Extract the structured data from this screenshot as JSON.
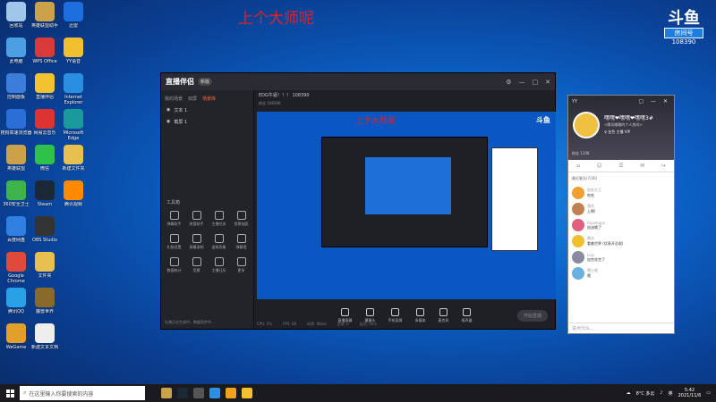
{
  "stream_title": "上个大师呢",
  "douyu": {
    "logo": "斗鱼",
    "room_label": "房间号",
    "room_id": "108390"
  },
  "desktop_icons": [
    {
      "label": "回收站",
      "color": "#9ec7e8"
    },
    {
      "label": "此电脑",
      "color": "#4aa0e0"
    },
    {
      "label": "控制面板",
      "color": "#3b7dd8"
    },
    {
      "label": "搜狗高速浏览器",
      "color": "#2a6fd6"
    },
    {
      "label": "英雄联盟",
      "color": "#caa24a"
    },
    {
      "label": "360安全卫士",
      "color": "#3db34a"
    },
    {
      "label": "百度网盘",
      "color": "#2f7fe0"
    },
    {
      "label": "Google Chrome",
      "color": "#e04a3a"
    },
    {
      "label": "腾讯QQ",
      "color": "#2aa0e6"
    },
    {
      "label": "WeGame",
      "color": "#e0a02a"
    },
    {
      "label": "英雄联盟助手",
      "color": "#caa24a"
    },
    {
      "label": "WPS Office",
      "color": "#d83a3a"
    },
    {
      "label": "直播伴侣",
      "color": "#f2c230"
    },
    {
      "label": "网易云音乐",
      "color": "#d33"
    },
    {
      "label": "微信",
      "color": "#2ec24a"
    },
    {
      "label": "Steam",
      "color": "#1b2838"
    },
    {
      "label": "OBS Studio",
      "color": "#333"
    },
    {
      "label": "文件夹",
      "color": "#e8c050"
    },
    {
      "label": "魔兽世界",
      "color": "#8a6a2a"
    },
    {
      "label": "新建文本文档",
      "color": "#eee"
    },
    {
      "label": "迅雷",
      "color": "#1d6fe0"
    },
    {
      "label": "YY语音",
      "color": "#f0c030"
    },
    {
      "label": "Internet Explorer",
      "color": "#2a8fe0"
    },
    {
      "label": "Microsoft Edge",
      "color": "#1a9a9a"
    },
    {
      "label": "新建文件夹",
      "color": "#e8c050"
    },
    {
      "label": "腾讯视频",
      "color": "#ff8a00"
    }
  ],
  "app": {
    "logo": "直播伴侣",
    "badge": "新版",
    "tabs": [
      "我的场景",
      "双屏",
      "场景库"
    ],
    "scenes": [
      "文本 1",
      "截屏 1"
    ],
    "room_name": "EDG牛逼！！！ 108390",
    "room_stats": "粉丝 108390",
    "toolbox_title": "工具箱",
    "tools": [
      "弹幕助手",
      "房管助手",
      "主播任务",
      "投票抽奖",
      "礼物设置",
      "屏幕录制",
      "虚拟形象",
      "弹幕墙",
      "数据统计",
      "竞猜",
      "主播日历",
      "更多"
    ],
    "status_text": "礼物正在生成中，数据同步中...",
    "preview_title": "上个大师呢",
    "preview_logo": "斗鱼",
    "toolbar": [
      "直播屏幕",
      "摄像头",
      "手机投屏",
      "多媒体",
      "麦克风",
      "扬声器"
    ],
    "start_live": "开始直播",
    "footer": [
      "CPU: 5%",
      "FPS: 60",
      "码率: 0kb/s",
      "丢帧: 0",
      "延迟: 0ms"
    ]
  },
  "chat": {
    "yy": "YY",
    "name": "嘿嘿❤嘿嘿❤嘿嘿3#",
    "sub": "<腾讯嘟嘟的个人房间>",
    "tags": "♀ 金色 主播 VIP",
    "fans": "粉丝 1108",
    "section": "最近聊天(7/30)",
    "messages": [
      {
        "name": "吃吃大王",
        "text": "吃吃",
        "color": "#f0a030"
      },
      {
        "name": "落花",
        "text": "上啊!",
        "color": "#c08050"
      },
      {
        "name": "Aiyamaya",
        "text": "加油哦了",
        "color": "#e06080"
      },
      {
        "name": "黄瓜",
        "text": "看着世界 (优表开总观)",
        "color": "#f0c030"
      },
      {
        "name": "Lisa",
        "text": "加完花完了",
        "color": "#8a8aa0"
      },
      {
        "name": "嗯小道",
        "text": "哦",
        "color": "#6ab0e0"
      }
    ],
    "input_placeholder": "说点什么..."
  },
  "taskbar": {
    "search_placeholder": "在这里输入你要搜索的内容",
    "weather": "8°C 多云",
    "ime": "英",
    "time": "5:42",
    "date": "2021/11/6"
  }
}
